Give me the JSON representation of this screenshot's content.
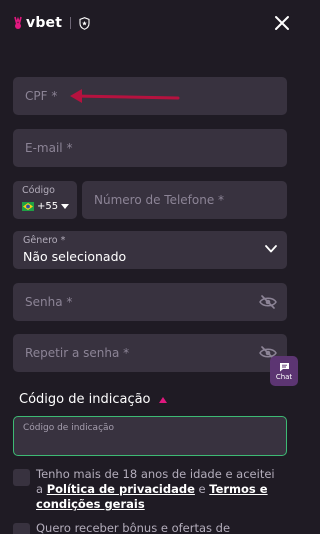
{
  "header": {
    "logo_text": "vbet",
    "icons": {
      "brand": "bunny-logo-icon",
      "secure": "shield-star-icon",
      "close": "close-icon"
    },
    "brand_color": "#e0187f"
  },
  "form": {
    "cpf_placeholder": "CPF *",
    "email_placeholder": "E-mail *",
    "phone": {
      "code_label": "Código",
      "code_value": "+55",
      "flag": "brazil-flag-icon",
      "number_placeholder": "Número de Telefone *"
    },
    "gender": {
      "label": "Gênero *",
      "value": "Não selecionado"
    },
    "password_placeholder": "Senha *",
    "repeat_password_placeholder": "Repetir a senha *"
  },
  "referral": {
    "title": "Código de indicação",
    "placeholder": "Código de indicação",
    "accent": "#3dba74"
  },
  "chat": {
    "label": "Chat"
  },
  "consent": {
    "age": {
      "prefix": "Tenho mais de 18 anos de idade e aceitei a",
      "privacy_link": "Política de privacidade",
      "joiner": "e",
      "terms_link": "Termos e condições gerais"
    },
    "bonus_text": "Quero receber bônus e ofertas de"
  },
  "annotation": {
    "arrow_color": "#b5123f"
  }
}
